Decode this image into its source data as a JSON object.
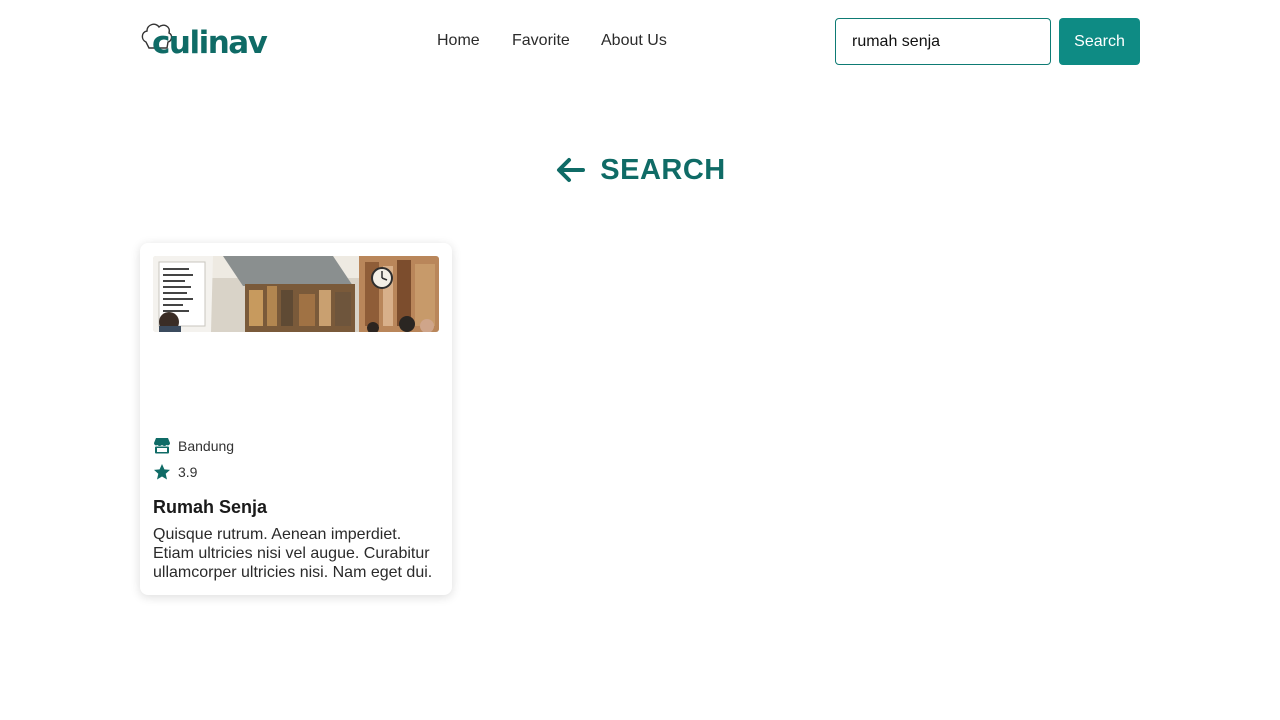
{
  "brand": {
    "name": "culinav",
    "color": "#0f6b66",
    "accent": "#0e8b84"
  },
  "nav": {
    "items": [
      {
        "label": "Home"
      },
      {
        "label": "Favorite"
      },
      {
        "label": "About Us"
      }
    ]
  },
  "search": {
    "value": "rumah senja",
    "button_label": "Search"
  },
  "page": {
    "title": "SEARCH",
    "back_icon": "arrow-left-icon"
  },
  "results": [
    {
      "city": "Bandung",
      "city_icon": "store-icon",
      "rating": "3.9",
      "rating_icon": "star-icon",
      "name": "Rumah Senja",
      "description": "Quisque rutrum. Aenean imperdiet. Etiam ultricies nisi vel augue. Curabitur ullamcorper ultricies nisi. Nam eget dui."
    }
  ]
}
